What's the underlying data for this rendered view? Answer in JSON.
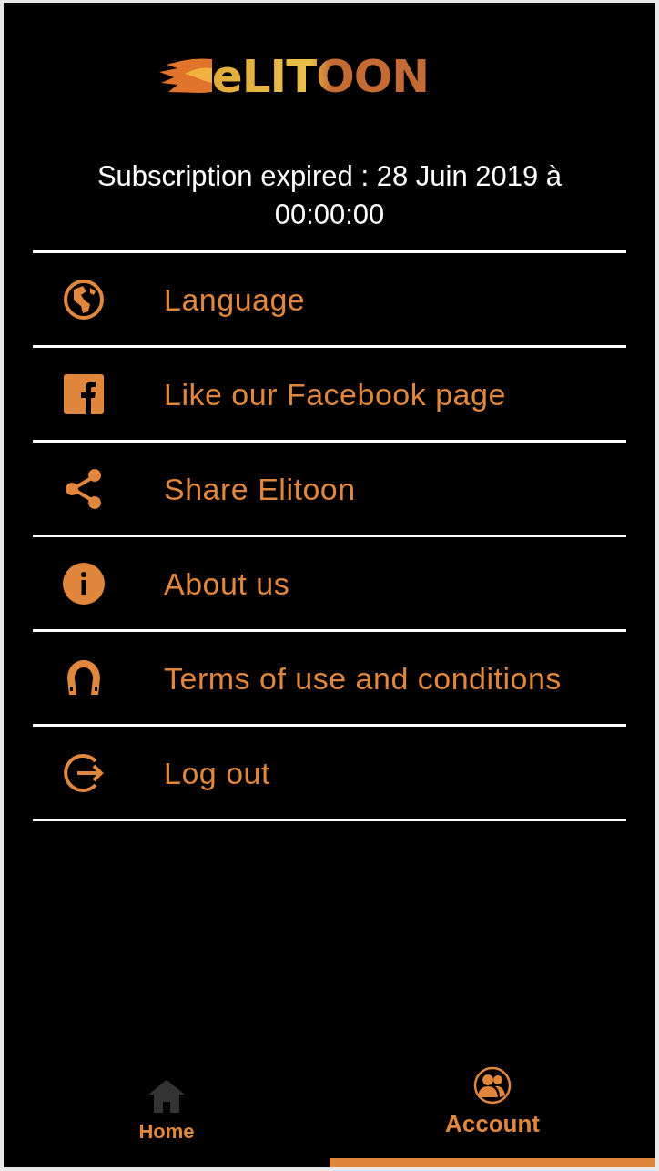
{
  "logo": {
    "text": "eLITOON"
  },
  "subscription": "Subscription expired : 28 Juin 2019 à 00:00:00",
  "menu": [
    {
      "kind": "globe",
      "label": "Language"
    },
    {
      "kind": "facebook",
      "label": "Like our Facebook page"
    },
    {
      "kind": "share",
      "label": "Share Elitoon"
    },
    {
      "kind": "info",
      "label": "About us"
    },
    {
      "kind": "horseshoe",
      "label": "Terms of use and conditions"
    },
    {
      "kind": "logout",
      "label": "Log out"
    }
  ],
  "tabs": [
    {
      "kind": "home",
      "label": "Home",
      "selected": false
    },
    {
      "kind": "account",
      "label": "Account",
      "selected": true
    }
  ]
}
